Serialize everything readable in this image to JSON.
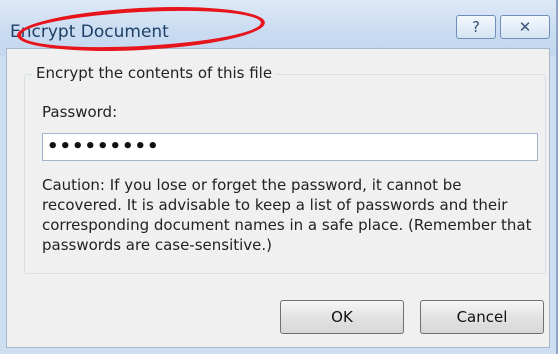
{
  "window": {
    "title": "Encrypt Document",
    "help_glyph": "?",
    "close_glyph": "✕"
  },
  "group": {
    "label": "Encrypt the contents of this file"
  },
  "password": {
    "label": "Password:",
    "value": "•••••••••"
  },
  "caution": "Caution: If you lose or forget the password, it cannot be recovered. It is advisable to keep a list of passwords and their corresponding document names in a safe place. (Remember that passwords are case-sensitive.)",
  "buttons": {
    "ok": "OK",
    "cancel": "Cancel"
  },
  "annotation": {
    "color": "#e8141c"
  }
}
